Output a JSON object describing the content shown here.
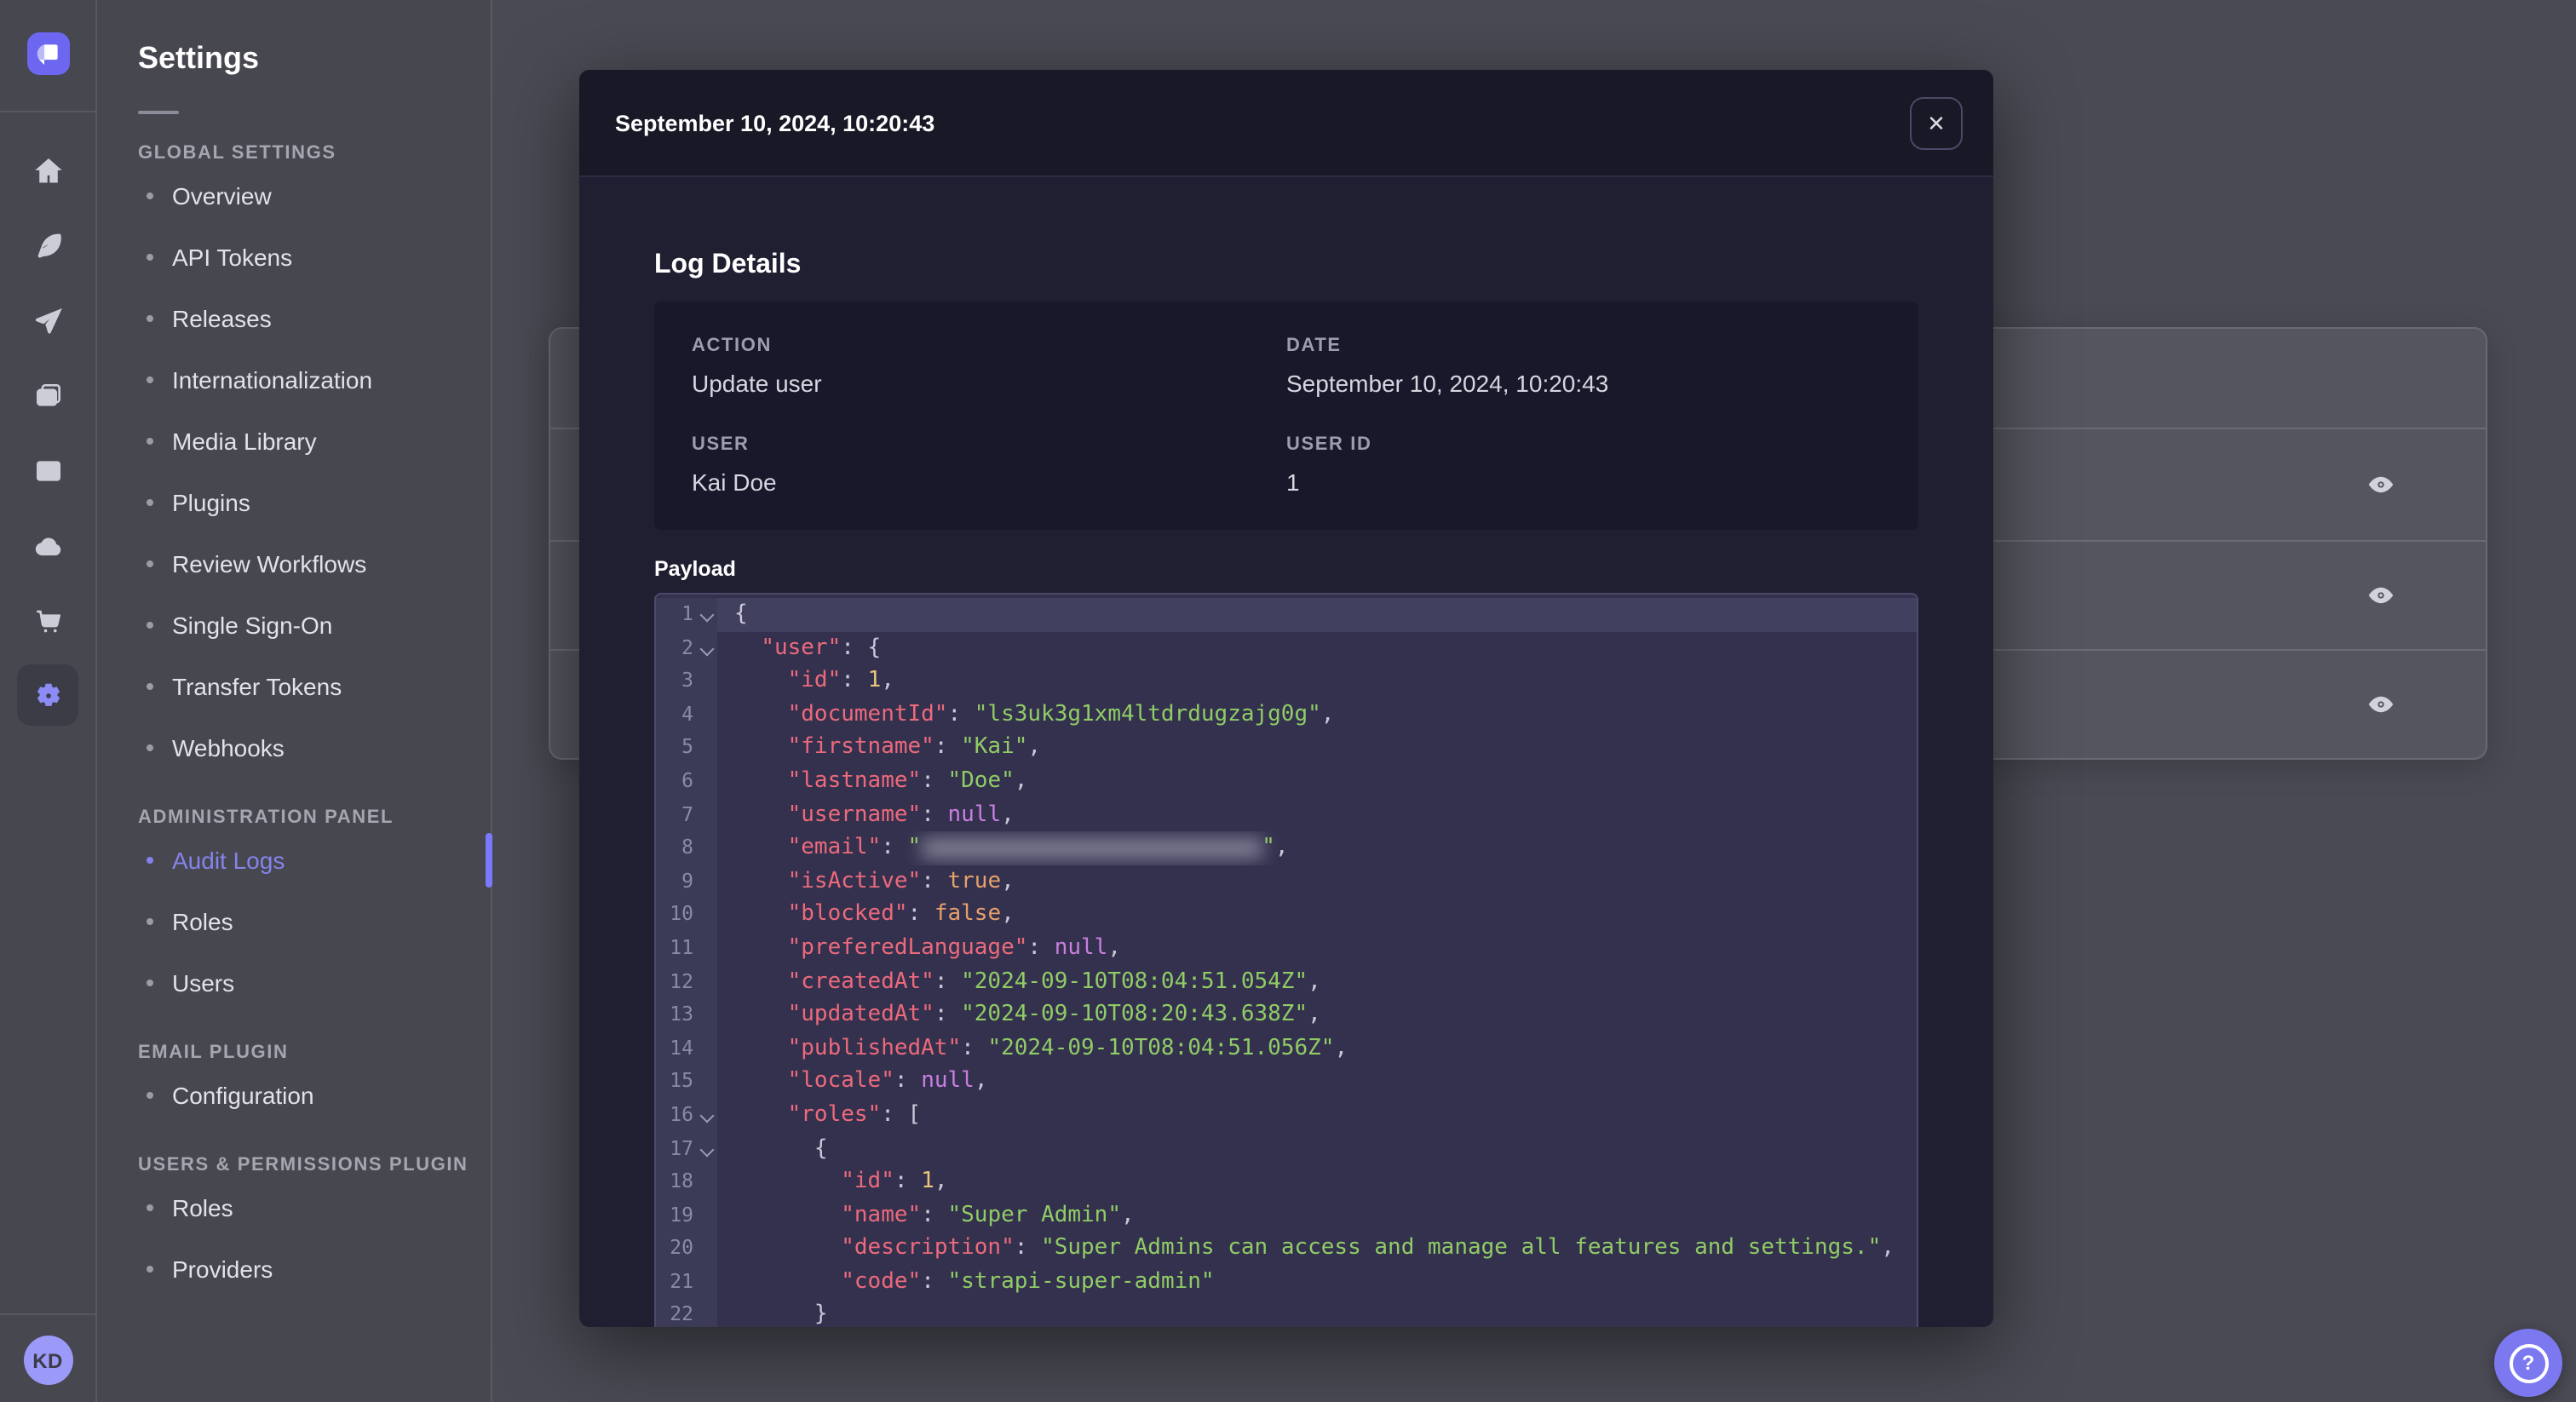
{
  "accent": "#7b79ff",
  "rail": {
    "logo_icon": "strapi-logo",
    "icons": [
      "home-icon",
      "feather-icon",
      "paper-plane-icon",
      "media-library-icon",
      "layout-icon",
      "cloud-icon",
      "cart-icon",
      "settings-gear-icon"
    ],
    "active_icon": "settings-gear-icon",
    "avatar_initials": "KD"
  },
  "sidebar": {
    "title": "Settings",
    "sections": [
      {
        "label": "GLOBAL SETTINGS",
        "items": [
          {
            "label": "Overview"
          },
          {
            "label": "API Tokens"
          },
          {
            "label": "Releases"
          },
          {
            "label": "Internationalization"
          },
          {
            "label": "Media Library"
          },
          {
            "label": "Plugins"
          },
          {
            "label": "Review Workflows"
          },
          {
            "label": "Single Sign-On"
          },
          {
            "label": "Transfer Tokens"
          },
          {
            "label": "Webhooks"
          }
        ]
      },
      {
        "label": "ADMINISTRATION PANEL",
        "items": [
          {
            "label": "Audit Logs",
            "active": true
          },
          {
            "label": "Roles"
          },
          {
            "label": "Users"
          }
        ]
      },
      {
        "label": "EMAIL PLUGIN",
        "items": [
          {
            "label": "Configuration"
          }
        ]
      },
      {
        "label": "USERS & PERMISSIONS PLUGIN",
        "items": [
          {
            "label": "Roles"
          },
          {
            "label": "Providers"
          }
        ]
      }
    ]
  },
  "background_table": {
    "visible_rows": 3,
    "row_action_icon": "eye-icon"
  },
  "help_button": {
    "icon": "question-mark-icon"
  },
  "modal": {
    "title": "September 10, 2024, 10:20:43",
    "close_icon": "close-icon",
    "section_title": "Log Details",
    "details": [
      {
        "label": "ACTION",
        "value": "Update user"
      },
      {
        "label": "DATE",
        "value": "September 10, 2024, 10:20:43"
      },
      {
        "label": "USER",
        "value": "Kai Doe"
      },
      {
        "label": "USER ID",
        "value": "1"
      }
    ],
    "payload_label": "Payload",
    "payload": {
      "email_redacted": true,
      "lines": [
        {
          "n": "1",
          "fold": true,
          "seg": [
            [
              "p",
              "{"
            ]
          ]
        },
        {
          "n": "2",
          "fold": true,
          "seg": [
            [
              "p",
              "  "
            ],
            [
              "k",
              "\"user\""
            ],
            [
              "p",
              ": {"
            ]
          ]
        },
        {
          "n": "3",
          "seg": [
            [
              "p",
              "    "
            ],
            [
              "k",
              "\"id\""
            ],
            [
              "p",
              ": "
            ],
            [
              "n",
              "1"
            ],
            [
              "p",
              ","
            ]
          ]
        },
        {
          "n": "4",
          "seg": [
            [
              "p",
              "    "
            ],
            [
              "k",
              "\"documentId\""
            ],
            [
              "p",
              ": "
            ],
            [
              "s",
              "\"ls3uk3g1xm4ltdrdugzajg0g\""
            ],
            [
              "p",
              ","
            ]
          ]
        },
        {
          "n": "5",
          "seg": [
            [
              "p",
              "    "
            ],
            [
              "k",
              "\"firstname\""
            ],
            [
              "p",
              ": "
            ],
            [
              "s",
              "\"Kai\""
            ],
            [
              "p",
              ","
            ]
          ]
        },
        {
          "n": "6",
          "seg": [
            [
              "p",
              "    "
            ],
            [
              "k",
              "\"lastname\""
            ],
            [
              "p",
              ": "
            ],
            [
              "s",
              "\"Doe\""
            ],
            [
              "p",
              ","
            ]
          ]
        },
        {
          "n": "7",
          "seg": [
            [
              "p",
              "    "
            ],
            [
              "k",
              "\"username\""
            ],
            [
              "p",
              ": "
            ],
            [
              "u",
              "null"
            ],
            [
              "p",
              ","
            ]
          ]
        },
        {
          "n": "8",
          "seg": [
            [
              "p",
              "    "
            ],
            [
              "k",
              "\"email\""
            ],
            [
              "p",
              ": "
            ],
            [
              "s",
              "\""
            ],
            [
              "blur",
              ""
            ],
            [
              "s",
              "\""
            ],
            [
              "p",
              ","
            ]
          ]
        },
        {
          "n": "9",
          "seg": [
            [
              "p",
              "    "
            ],
            [
              "k",
              "\"isActive\""
            ],
            [
              "p",
              ": "
            ],
            [
              "b",
              "true"
            ],
            [
              "p",
              ","
            ]
          ]
        },
        {
          "n": "10",
          "seg": [
            [
              "p",
              "    "
            ],
            [
              "k",
              "\"blocked\""
            ],
            [
              "p",
              ": "
            ],
            [
              "b",
              "false"
            ],
            [
              "p",
              ","
            ]
          ]
        },
        {
          "n": "11",
          "seg": [
            [
              "p",
              "    "
            ],
            [
              "k",
              "\"preferedLanguage\""
            ],
            [
              "p",
              ": "
            ],
            [
              "u",
              "null"
            ],
            [
              "p",
              ","
            ]
          ]
        },
        {
          "n": "12",
          "seg": [
            [
              "p",
              "    "
            ],
            [
              "k",
              "\"createdAt\""
            ],
            [
              "p",
              ": "
            ],
            [
              "s",
              "\"2024-09-10T08:04:51.054Z\""
            ],
            [
              "p",
              ","
            ]
          ]
        },
        {
          "n": "13",
          "seg": [
            [
              "p",
              "    "
            ],
            [
              "k",
              "\"updatedAt\""
            ],
            [
              "p",
              ": "
            ],
            [
              "s",
              "\"2024-09-10T08:20:43.638Z\""
            ],
            [
              "p",
              ","
            ]
          ]
        },
        {
          "n": "14",
          "seg": [
            [
              "p",
              "    "
            ],
            [
              "k",
              "\"publishedAt\""
            ],
            [
              "p",
              ": "
            ],
            [
              "s",
              "\"2024-09-10T08:04:51.056Z\""
            ],
            [
              "p",
              ","
            ]
          ]
        },
        {
          "n": "15",
          "seg": [
            [
              "p",
              "    "
            ],
            [
              "k",
              "\"locale\""
            ],
            [
              "p",
              ": "
            ],
            [
              "u",
              "null"
            ],
            [
              "p",
              ","
            ]
          ]
        },
        {
          "n": "16",
          "fold": true,
          "seg": [
            [
              "p",
              "    "
            ],
            [
              "k",
              "\"roles\""
            ],
            [
              "p",
              ": ["
            ]
          ]
        },
        {
          "n": "17",
          "fold": true,
          "seg": [
            [
              "p",
              "      {"
            ]
          ]
        },
        {
          "n": "18",
          "seg": [
            [
              "p",
              "        "
            ],
            [
              "k",
              "\"id\""
            ],
            [
              "p",
              ": "
            ],
            [
              "n",
              "1"
            ],
            [
              "p",
              ","
            ]
          ]
        },
        {
          "n": "19",
          "seg": [
            [
              "p",
              "        "
            ],
            [
              "k",
              "\"name\""
            ],
            [
              "p",
              ": "
            ],
            [
              "s",
              "\"Super Admin\""
            ],
            [
              "p",
              ","
            ]
          ]
        },
        {
          "n": "20",
          "seg": [
            [
              "p",
              "        "
            ],
            [
              "k",
              "\"description\""
            ],
            [
              "p",
              ": "
            ],
            [
              "s",
              "\"Super Admins can access and manage all features and settings.\""
            ],
            [
              "p",
              ","
            ]
          ]
        },
        {
          "n": "21",
          "seg": [
            [
              "p",
              "        "
            ],
            [
              "k",
              "\"code\""
            ],
            [
              "p",
              ": "
            ],
            [
              "s",
              "\"strapi-super-admin\""
            ]
          ]
        },
        {
          "n": "22",
          "seg": [
            [
              "p",
              "      }"
            ]
          ]
        }
      ]
    }
  }
}
